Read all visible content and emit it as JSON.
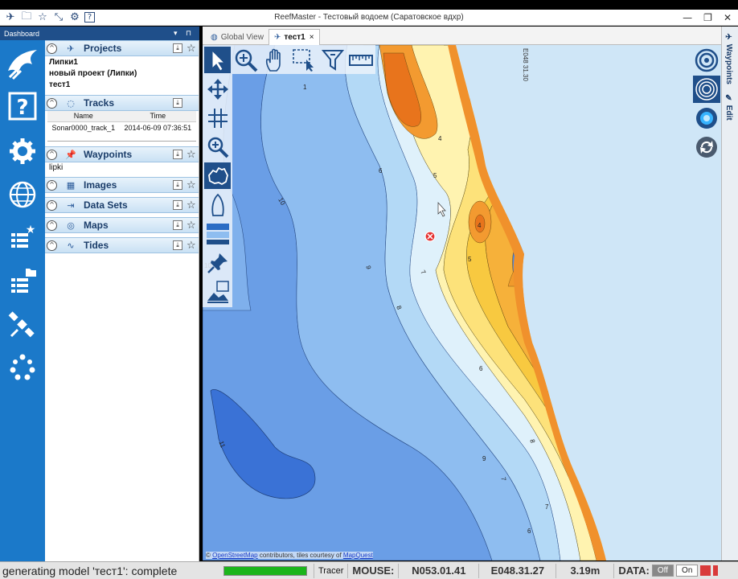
{
  "window": {
    "title": "ReefMaster - Тестовый водоем (Саратовское вдхр)",
    "minimize_glyph": "—",
    "restore_glyph": "❐",
    "close_glyph": "✕"
  },
  "dashboard": {
    "header": "Dashboard",
    "controls": "▾ ⊓"
  },
  "sections": {
    "projects": {
      "title": "Projects",
      "items": [
        "Липки1",
        "новый проект (Липки)",
        "тест1"
      ]
    },
    "tracks": {
      "title": "Tracks",
      "columns": [
        "Name",
        "Time"
      ],
      "rows": [
        {
          "name": "Sonar0000_track_1",
          "time": "2014-06-09 07:36:51"
        }
      ]
    },
    "waypoints": {
      "title": "Waypoints",
      "items": [
        "lipki"
      ]
    },
    "images": {
      "title": "Images"
    },
    "datasets": {
      "title": "Data Sets"
    },
    "maps": {
      "title": "Maps"
    },
    "tides": {
      "title": "Tides"
    }
  },
  "tabs": [
    {
      "label": "Global View",
      "icon": "globe-icon"
    },
    {
      "label": "тест1",
      "icon": "tool-icon",
      "close": "×"
    }
  ],
  "map": {
    "coord_label": "E048 31.30",
    "depth_labels": [
      "10",
      "9",
      "8",
      "7",
      "6",
      "5",
      "4",
      "1",
      "11",
      "10",
      "9",
      "8",
      "7",
      "6",
      "5",
      "4",
      "7",
      "6"
    ],
    "attribution": {
      "copyright": "©",
      "osm": "OpenStreetMap",
      "middle": "contributors, tiles courtesy of",
      "mapquest": "MapQuest"
    }
  },
  "right_tabs": [
    "Waypoints",
    "Edit"
  ],
  "status": {
    "message": "generating model 'тест1': complete",
    "progress_percent": 100,
    "tracer": "Tracer",
    "mouse_label": "MOUSE:",
    "lat": "N053.01.41",
    "lon": "E048.31.27",
    "depth": "3.19m",
    "data_label": "DATA:",
    "off": "Off",
    "on": "On"
  },
  "colors": {
    "brand_blue": "#1b79c9",
    "header_blue": "#1f4f8a",
    "progress_green": "#1bb51b"
  }
}
